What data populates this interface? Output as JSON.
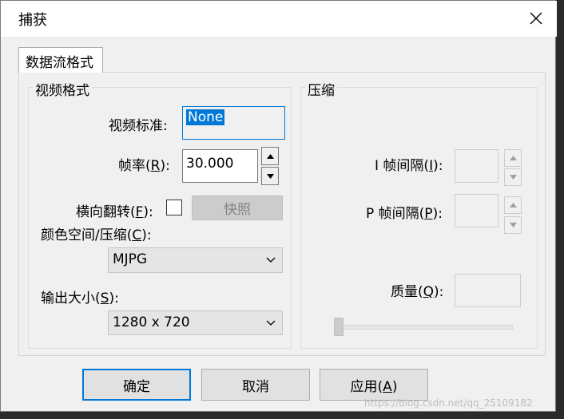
{
  "window": {
    "title": "捕获"
  },
  "tab": {
    "label": "数据流格式"
  },
  "video_format": {
    "group_label": "视频格式",
    "standard_label": "视频标准:",
    "standard_value": "None",
    "framerate_label_prefix": "帧率(",
    "framerate_label_key": "R",
    "framerate_label_suffix": "):",
    "framerate_value": "30.000",
    "flip_label_prefix": "横向翻转(",
    "flip_label_key": "F",
    "flip_label_suffix": "):",
    "flip_checked": false,
    "snapshot_label": "快照",
    "colorspace_label_prefix": "颜色空间/压缩(",
    "colorspace_label_key": "C",
    "colorspace_label_suffix": "):",
    "colorspace_value": "MJPG",
    "output_label_prefix": "输出大小(",
    "output_label_key": "S",
    "output_label_suffix": "):",
    "output_value": "1280 x 720"
  },
  "compression": {
    "group_label": "压缩",
    "iframe_label_prefix": "I 帧间隔(",
    "iframe_label_key": "I",
    "iframe_label_suffix": "):",
    "iframe_value": "",
    "pframe_label_prefix": "P 帧间隔(",
    "pframe_label_key": "P",
    "pframe_label_suffix": "):",
    "pframe_value": "",
    "quality_label_prefix": "质量(",
    "quality_label_key": "Q",
    "quality_label_suffix": "):",
    "quality_value": "",
    "quality_level": 0
  },
  "buttons": {
    "ok": "确定",
    "cancel": "取消",
    "apply_prefix": "应用(",
    "apply_key": "A",
    "apply_suffix": ")"
  },
  "watermark": "https://blog.csdn.net/qq_25109182"
}
